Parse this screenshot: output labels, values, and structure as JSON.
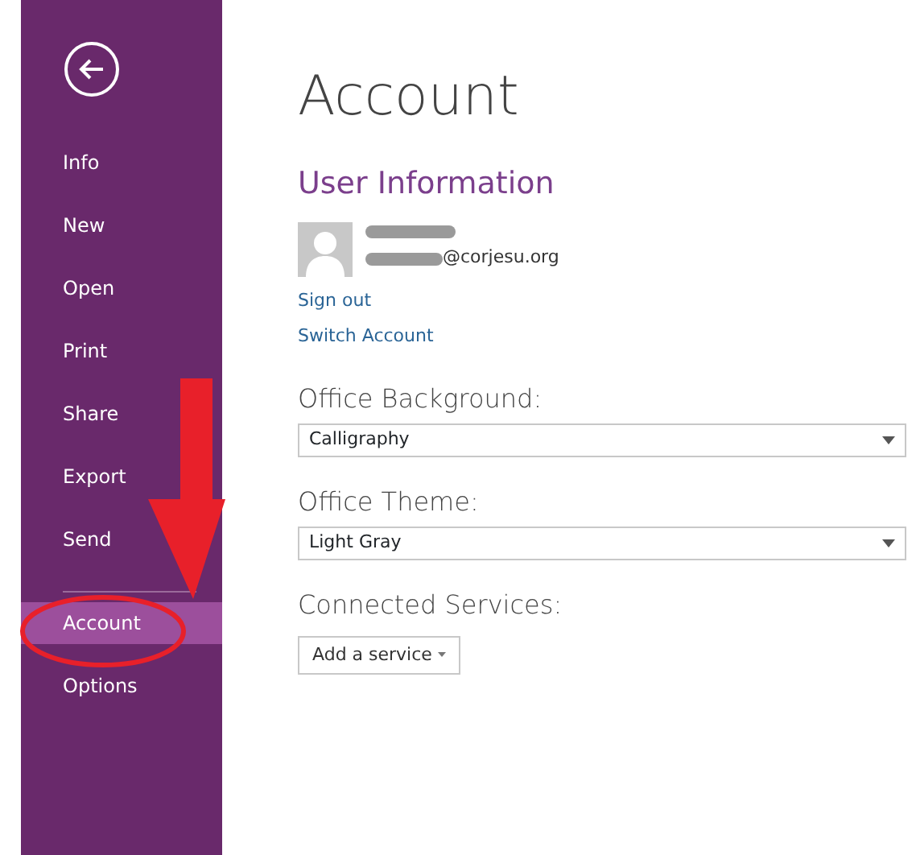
{
  "sidebar": {
    "items": [
      {
        "label": "Info",
        "selected": false
      },
      {
        "label": "New",
        "selected": false
      },
      {
        "label": "Open",
        "selected": false
      },
      {
        "label": "Print",
        "selected": false
      },
      {
        "label": "Share",
        "selected": false
      },
      {
        "label": "Export",
        "selected": false
      },
      {
        "label": "Send",
        "selected": false
      },
      {
        "label": "Account",
        "selected": true
      },
      {
        "label": "Options",
        "selected": false
      }
    ]
  },
  "page": {
    "title": "Account",
    "user_information": {
      "heading": "User Information",
      "email": "@corjesu.org",
      "links": [
        "Sign out",
        "Switch Account"
      ]
    },
    "settings": [
      {
        "label": "Office Background:",
        "value": "Calligraphy"
      },
      {
        "label": "Office Theme:",
        "value": "Light Gray"
      }
    ],
    "connected_services": {
      "label": "Connected Services:",
      "button": "Add a service"
    }
  }
}
